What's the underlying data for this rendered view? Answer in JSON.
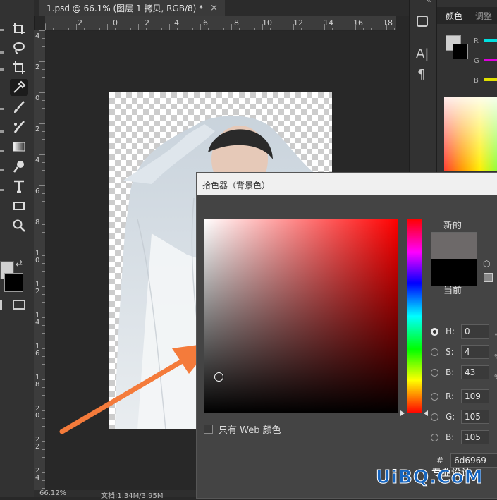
{
  "document_tab": {
    "title": "1.psd @ 66.1% (图层 1 拷贝, RGB/8) *",
    "close": "×"
  },
  "ruler": {
    "top_labels": [
      "4",
      "2",
      "0",
      "2",
      "4",
      "6",
      "8",
      "10",
      "12",
      "14",
      "16",
      "18"
    ],
    "left_labels": [
      "4",
      "2",
      "0",
      "2",
      "4",
      "6",
      "8",
      "10",
      "12",
      "14",
      "16",
      "18",
      "20",
      "22",
      "24"
    ]
  },
  "status": {
    "zoom": "66.12%",
    "doc_info": "文档:1.34M/3.95M"
  },
  "panel": {
    "tab_color": "颜色",
    "tab_adjust": "调整",
    "channels": [
      "R",
      "G",
      "B"
    ]
  },
  "picker": {
    "title": "拾色器（背景色）",
    "new_label": "新的",
    "current_label": "当前",
    "web_only_label": "只有 Web 颜色",
    "fields": [
      {
        "label": "H:",
        "value": "0",
        "selected": true
      },
      {
        "label": "S:",
        "value": "4",
        "selected": false
      },
      {
        "label": "B:",
        "value": "43",
        "selected": false
      },
      {
        "label": "R:",
        "value": "109",
        "selected": false
      },
      {
        "label": "G:",
        "value": "105",
        "selected": false
      },
      {
        "label": "B:",
        "value": "105",
        "selected": false
      }
    ],
    "hex_label": "#",
    "hex_value": "6d6969",
    "new_color": "#6d6969",
    "current_color": "#000000"
  },
  "colors": {
    "foreground": "#d0d0d0",
    "background": "#000000",
    "arrow": "#f47b3b"
  },
  "watermark": {
    "text": "UiBQ.CoM",
    "sub": "专业设计"
  }
}
